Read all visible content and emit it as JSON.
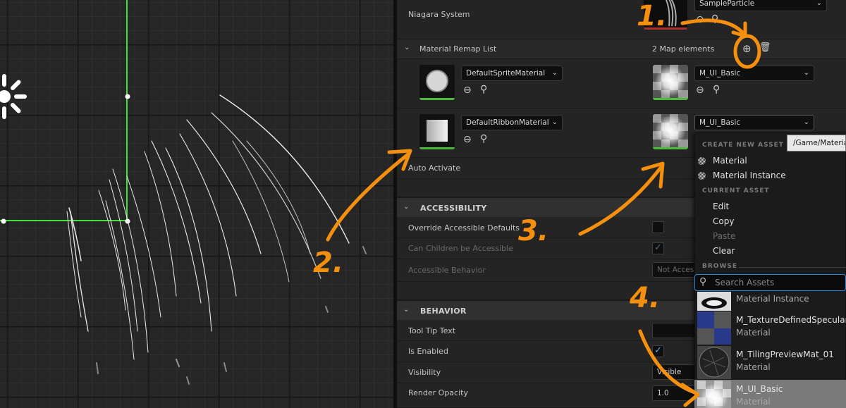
{
  "details": {
    "niagara_system_label": "Niagara System",
    "niagara_system_value": "SampleParticle",
    "material_remap": {
      "label": "Material Remap List",
      "count_text": "2 Map elements",
      "entries": [
        {
          "key": "DefaultSpriteMaterial",
          "value": "M_UI_Basic"
        },
        {
          "key": "DefaultRibbonMaterial",
          "value": "M_UI_Basic"
        }
      ]
    },
    "auto_activate_label": "Auto Activate",
    "accessibility": {
      "header": "ACCESSIBILITY",
      "override_label": "Override Accessible Defaults",
      "children_label": "Can Children be Accessible",
      "behavior_label": "Accessible Behavior",
      "behavior_value": "Not Access"
    },
    "behavior": {
      "header": "BEHAVIOR",
      "tooltip_label": "Tool Tip Text",
      "enabled_label": "Is Enabled",
      "visibility_label": "Visibility",
      "visibility_value": "Visible",
      "opacity_label": "Render Opacity",
      "opacity_value": "1.0"
    }
  },
  "popup": {
    "tooltip_path": "/Game/Materia",
    "create_header": "CREATE NEW ASSET",
    "create_items": [
      "Material",
      "Material Instance"
    ],
    "current_header": "CURRENT ASSET",
    "current_items": [
      "Edit",
      "Copy",
      "Paste",
      "Clear"
    ],
    "browse_header": "BROWSE",
    "search_placeholder": "Search Assets",
    "assets": [
      {
        "name": "",
        "type": "Material Instance"
      },
      {
        "name": "M_TextureDefinedSpecularRe",
        "type": "Material"
      },
      {
        "name": "M_TilingPreviewMat_01",
        "type": "Material"
      },
      {
        "name": "M_UI_Basic",
        "type": "Material"
      }
    ]
  },
  "annotations": [
    "1.",
    "2.",
    "3.",
    "4."
  ],
  "colors": {
    "accent_green": "#4cbb3c",
    "annotation_orange": "#f5900f",
    "selection_blue": "#2a8ad8"
  }
}
